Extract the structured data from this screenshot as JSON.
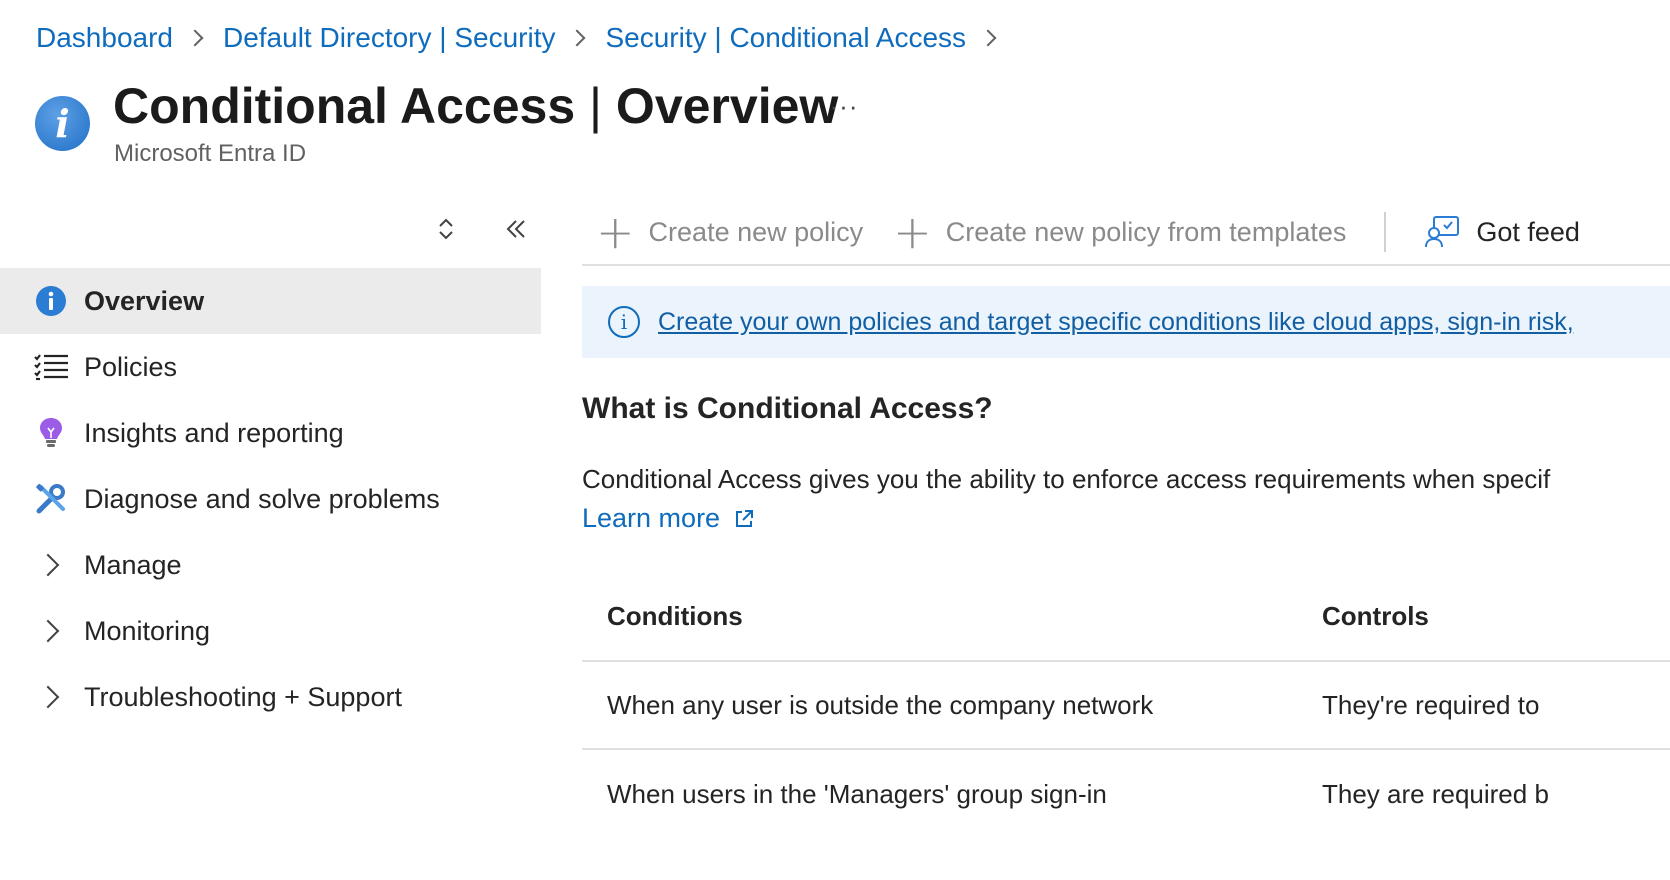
{
  "breadcrumb": [
    "Dashboard",
    "Default Directory | Security",
    "Security | Conditional Access"
  ],
  "header": {
    "title_bold": "Conditional Access",
    "title_sep": " | ",
    "title_rest": "Overview",
    "more": "···",
    "subtitle": "Microsoft Entra ID"
  },
  "sidebar": {
    "items": [
      {
        "label": "Overview",
        "icon": "info-icon",
        "active": true
      },
      {
        "label": "Policies",
        "icon": "list-icon"
      },
      {
        "label": "Insights and reporting",
        "icon": "lightbulb-icon"
      },
      {
        "label": "Diagnose and solve problems",
        "icon": "wrench-icon"
      },
      {
        "label": "Manage",
        "icon": "chevron-right-icon"
      },
      {
        "label": "Monitoring",
        "icon": "chevron-right-icon"
      },
      {
        "label": "Troubleshooting + Support",
        "icon": "chevron-right-icon"
      }
    ]
  },
  "toolbar": {
    "create_policy": "Create new policy",
    "create_from_templates": "Create new policy from templates",
    "feedback": "Got feed"
  },
  "banner": {
    "text": "Create your own policies and target specific conditions like cloud apps, sign-in risk, ",
    "icon": "info-circle-icon"
  },
  "content": {
    "heading": "What is Conditional Access?",
    "paragraph": "Conditional Access gives you the ability to enforce access requirements when specif",
    "learn_more": "Learn more"
  },
  "table": {
    "headers": [
      "Conditions",
      "Controls"
    ],
    "rows": [
      [
        "When any user is outside the company network",
        "They're required to"
      ],
      [
        "When users in the 'Managers' group sign-in",
        "They are required b"
      ]
    ]
  },
  "colors": {
    "link": "#0f6cbd",
    "active_nav_bg": "#ebebeb",
    "banner_bg": "#ebf3fc"
  }
}
